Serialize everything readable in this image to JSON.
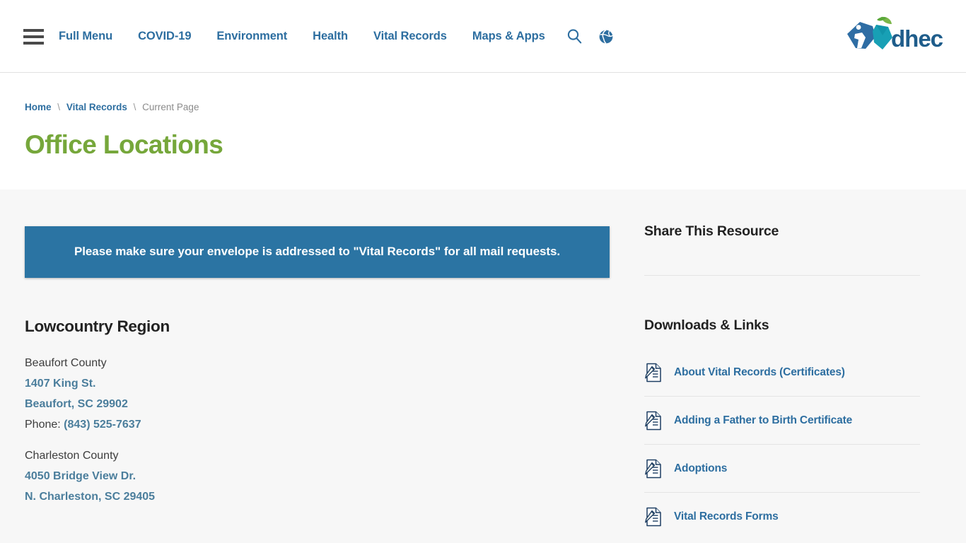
{
  "header": {
    "menu_icon": "hamburger-menu-icon",
    "nav": [
      {
        "label": "Full Menu"
      },
      {
        "label": "COVID-19"
      },
      {
        "label": "Environment"
      },
      {
        "label": "Health"
      },
      {
        "label": "Vital Records"
      },
      {
        "label": "Maps & Apps"
      }
    ],
    "search_icon": "search-icon",
    "globe_icon": "globe-icon",
    "logo_text": "dhec",
    "logo_alt": "dhec-logo"
  },
  "breadcrumb": {
    "items": [
      {
        "label": "Home",
        "type": "link"
      },
      {
        "label": "Vital Records",
        "type": "link"
      },
      {
        "label": "Current Page",
        "type": "current"
      }
    ],
    "separator": "\\"
  },
  "page": {
    "title": "Office Locations"
  },
  "alert": {
    "message": "Please make sure your envelope is addressed to \"Vital Records\" for all mail requests."
  },
  "main": {
    "region_heading": "Lowcountry Region",
    "offices": [
      {
        "county": "Beaufort County",
        "street": "1407 King St.",
        "citystate": "Beaufort, SC 29902",
        "phone_label": "Phone:",
        "phone": "(843) 525-7637"
      },
      {
        "county": "Charleston County",
        "street": "4050 Bridge View Dr.",
        "citystate": "N. Charleston, SC 29405"
      }
    ]
  },
  "sidebar": {
    "share_heading": "Share This Resource",
    "downloads_heading": "Downloads & Links",
    "downloads": [
      {
        "label": "About Vital Records (Certificates)",
        "icon": "document-pen-icon"
      },
      {
        "label": "Adding a Father to Birth Certificate",
        "icon": "document-pen-icon"
      },
      {
        "label": "Adoptions",
        "icon": "document-pen-icon"
      },
      {
        "label": "Vital Records Forms",
        "icon": "document-pen-icon"
      }
    ]
  },
  "colors": {
    "nav_link": "#2d6ea0",
    "title_green": "#76a73b",
    "title_rule_teal": "#16a8cc",
    "alert_blue": "#2b74a3",
    "content_bg": "#f7f7f7",
    "address_link": "#4b7e9c"
  }
}
